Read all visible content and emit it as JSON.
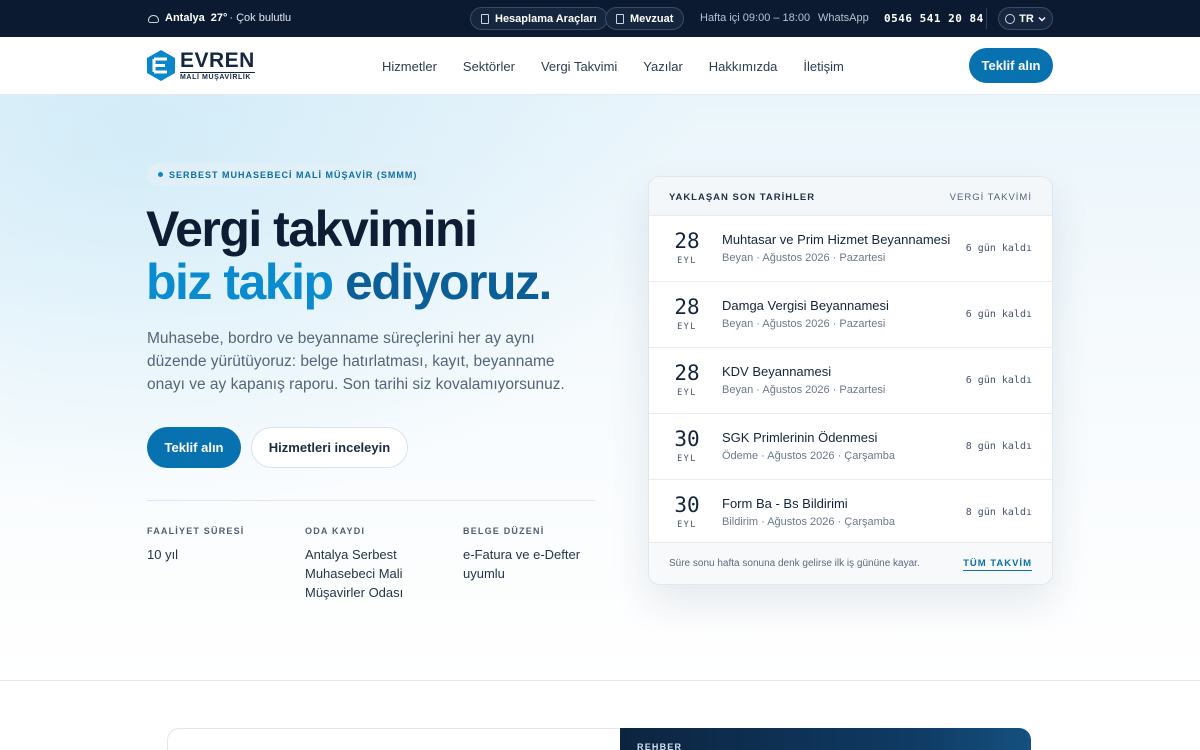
{
  "topbar": {
    "weather_city": "Antalya",
    "weather_temp": "27°",
    "weather_desc": "· Çok bulutlu",
    "tools_label": "Hesaplama Araçları",
    "legislation_label": "Mevzuat",
    "hours": "Hafta içi 09:00 – 18:00",
    "whatsapp_label": "WhatsApp",
    "phone": "0546 541 20 84",
    "lang": "TR"
  },
  "brand": {
    "name": "EVREN",
    "subtitle": "MALİ MÜŞAVİRLİK",
    "accent": "#0872b0"
  },
  "nav": {
    "items": [
      "Hizmetler",
      "Sektörler",
      "Vergi Takvimi",
      "Yazılar",
      "Hakkımızda",
      "İletişim"
    ],
    "cta": "Teklif alın"
  },
  "hero": {
    "badge": "SERBEST MUHASEBECİ MALİ MÜŞAVİR (SMMM)",
    "title_line1": "Vergi takvimini",
    "title_line2_a": "biz takip",
    "title_line2_b": "ediyoruz.",
    "lead": "Muhasebe, bordro ve beyanname süreçlerini her ay aynı düzende yürütüyoruz: belge hatırlatması, kayıt, beyanname onayı ve ay kapanış raporu. Son tarihi siz kovalamıyorsunuz.",
    "primary_button": "Teklif alın",
    "secondary_button": "Hizmetleri inceleyin",
    "facts": [
      {
        "label": "FAALİYET SÜRESİ",
        "value": "10 yıl"
      },
      {
        "label": "ODA KAYDI",
        "value": "Antalya Serbest Muhasebeci Mali Müşavirler Odası"
      },
      {
        "label": "BELGE DÜZENİ",
        "value": "e-Fatura ve e-Defter uyumlu"
      }
    ]
  },
  "deadlines": {
    "title": "YAKLAŞAN SON TARİHLER",
    "link": "VERGİ TAKVİMİ",
    "items": [
      {
        "day": "28",
        "month": "EYL",
        "title": "Muhtasar ve Prim Hizmet Beyannamesi",
        "meta": "Beyan · Ağustos 2026 · Pazartesi",
        "remaining": "6 gün kaldı"
      },
      {
        "day": "28",
        "month": "EYL",
        "title": "Damga Vergisi Beyannamesi",
        "meta": "Beyan · Ağustos 2026 · Pazartesi",
        "remaining": "6 gün kaldı"
      },
      {
        "day": "28",
        "month": "EYL",
        "title": "KDV Beyannamesi",
        "meta": "Beyan · Ağustos 2026 · Pazartesi",
        "remaining": "6 gün kaldı"
      },
      {
        "day": "30",
        "month": "EYL",
        "title": "SGK Primlerinin Ödenmesi",
        "meta": "Ödeme · Ağustos 2026 · Çarşamba",
        "remaining": "8 gün kaldı"
      },
      {
        "day": "30",
        "month": "EYL",
        "title": "Form Ba - Bs Bildirimi",
        "meta": "Bildirim · Ağustos 2026 · Çarşamba",
        "remaining": "8 gün kaldı"
      }
    ],
    "footnote": "Süre sonu hafta sonuna denk gelirse ilk iş gününe kayar.",
    "all_link": "TÜM TAKVİM"
  },
  "lower": {
    "guide_label": "REHBER"
  }
}
